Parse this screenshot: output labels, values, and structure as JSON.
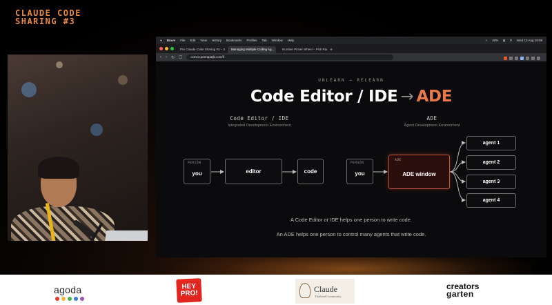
{
  "event": {
    "title": "CLAUDE CODE SHARING #3"
  },
  "mac_menu": {
    "app": "Brave",
    "items": [
      "File",
      "Edit",
      "View",
      "History",
      "Bookmarks",
      "Profiles",
      "Tab",
      "Window",
      "Help"
    ],
    "battery": "40%",
    "clock": "Wed 13 Aug 19:08"
  },
  "browser": {
    "tabs": [
      {
        "label": "Pre Claude Code Sharing #3 – Sli…",
        "active": false
      },
      {
        "label": "Managing Multiple Coding Ag…",
        "active": true
      },
      {
        "label": "Number Picker Wheel – Pick Rand…",
        "active": false
      }
    ],
    "url": "ccmc3.peerapatjk.com/ll"
  },
  "slide": {
    "eyebrow": "UNLEARN → RELEARN",
    "headline_left": "Code Editor / IDE",
    "headline_arrow": "→",
    "headline_right": "ADE",
    "left": {
      "title": "Code Editor / IDE",
      "subtitle": "Integrated Development Environment",
      "person_tag": "PERSON",
      "person_label": "you",
      "editor_label": "editor",
      "code_label": "code"
    },
    "right": {
      "title": "ADE",
      "subtitle": "Agent Development Environment",
      "person_tag": "PERSON",
      "person_label": "you",
      "ade_tag": "ADE",
      "ade_label": "ADE window",
      "agents": [
        "agent 1",
        "agent 2",
        "agent 3",
        "agent 4"
      ]
    },
    "caption_1": "A Code Editor or IDE helps one person to write code.",
    "caption_2": "An ADE helps one person to control many agents that write code."
  },
  "sponsors": {
    "agoda": "agoda",
    "agoda_dot_colors": [
      "#e23a3a",
      "#f2b33d",
      "#4bb04a",
      "#3a7bd5",
      "#9b59b6"
    ],
    "heypro": "HEY PRO!",
    "claude": "Claude",
    "claude_sub": "Thailand Community",
    "creators_1": "creators",
    "creators_2": "garten"
  }
}
